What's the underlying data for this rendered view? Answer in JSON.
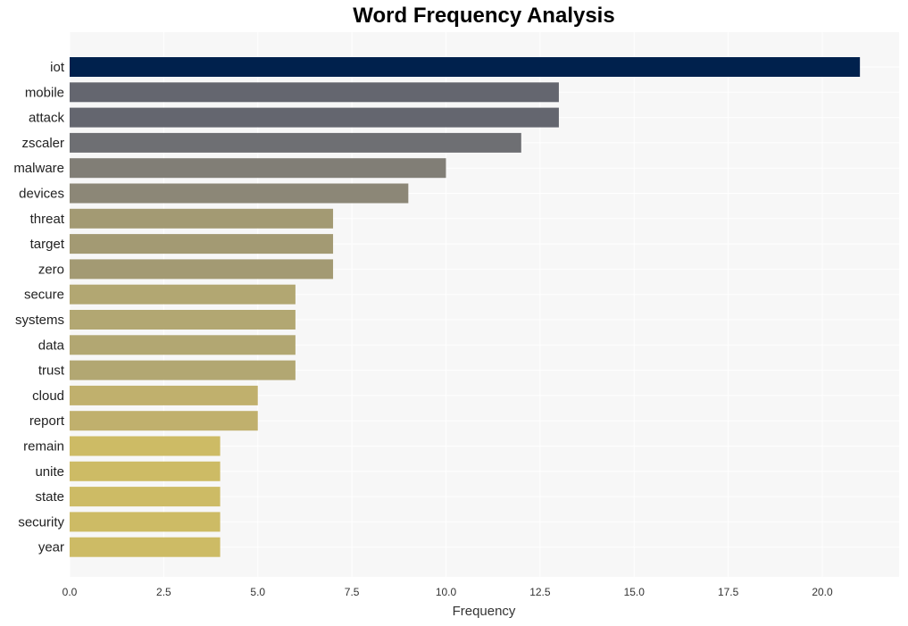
{
  "chart_data": {
    "type": "bar",
    "orientation": "horizontal",
    "title": "Word Frequency Analysis",
    "xlabel": "Frequency",
    "ylabel": "",
    "xlim": [
      0,
      22
    ],
    "xticks": [
      0.0,
      2.5,
      5.0,
      7.5,
      10.0,
      12.5,
      15.0,
      17.5,
      20.0
    ],
    "xtick_labels": [
      "0.0",
      "2.5",
      "5.0",
      "7.5",
      "10.0",
      "12.5",
      "15.0",
      "17.5",
      "20.0"
    ],
    "grid": true,
    "legend": "none",
    "categories": [
      "iot",
      "mobile",
      "attack",
      "zscaler",
      "malware",
      "devices",
      "threat",
      "target",
      "zero",
      "secure",
      "systems",
      "data",
      "trust",
      "cloud",
      "report",
      "remain",
      "unite",
      "state",
      "security",
      "year"
    ],
    "values": [
      21,
      13,
      13,
      12,
      10,
      9,
      7,
      7,
      7,
      6,
      6,
      6,
      6,
      5,
      5,
      4,
      4,
      4,
      4,
      4
    ],
    "colors": [
      "#00214d",
      "#64666f",
      "#64666f",
      "#6e6f73",
      "#817e76",
      "#8c8777",
      "#a39a73",
      "#a39a73",
      "#a39a73",
      "#b2a772",
      "#b2a772",
      "#b2a772",
      "#b2a772",
      "#c0b06d",
      "#c0b06d",
      "#cdbb65",
      "#cdbb65",
      "#cdbb65",
      "#cdbb65",
      "#cdbb65"
    ],
    "background_color": "#f7f7f7"
  }
}
